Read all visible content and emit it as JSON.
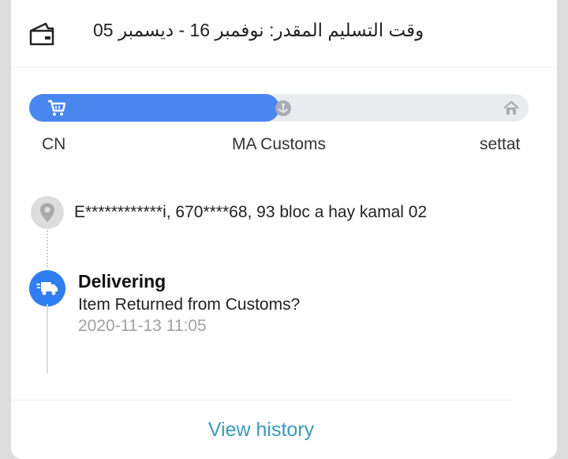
{
  "header": {
    "icon": "delivery-box-icon",
    "estimated_delivery": "وقت التسليم المقدر: نوفمبر 16 - ديسمبر 05"
  },
  "progress": {
    "fraction": 0.5,
    "colors": {
      "fill": "#4a86ef",
      "track": "#e9ebef"
    },
    "nodes": [
      {
        "label": "CN",
        "icon": "cart-icon"
      },
      {
        "label": "MA Customs",
        "icon": "customs-icon"
      },
      {
        "label": "settat",
        "icon": "home-icon"
      }
    ]
  },
  "address": {
    "icon": "location-pin-icon",
    "text": "E************i,  670****68,  93 bloc a hay kamal 02"
  },
  "event": {
    "icon": "truck-icon",
    "status": "Delivering",
    "description": "Item Returned from Customs?",
    "time": "2020-11-13 11:05"
  },
  "footer": {
    "view_history": "View history"
  }
}
